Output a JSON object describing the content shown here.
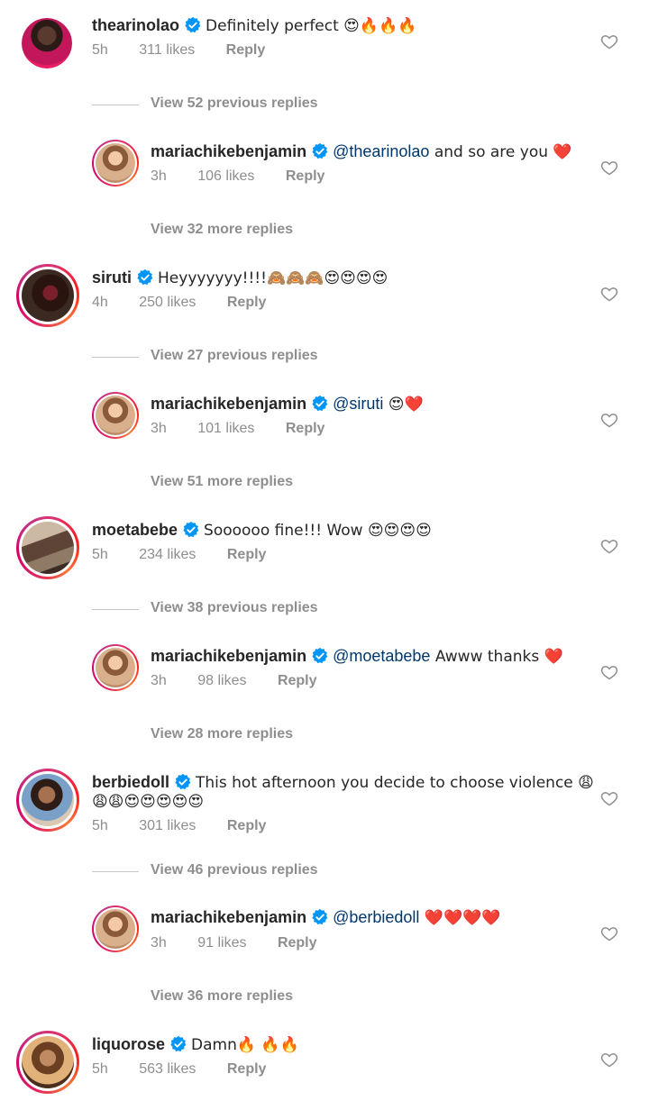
{
  "comments": [
    {
      "username": "thearinolao",
      "text": "Definitely perfect 😍🔥🔥🔥",
      "time": "5h",
      "likes": "311 likes",
      "reply": "Reply",
      "view_label": "View 52 previous replies",
      "reply_item": {
        "username": "mariachikebenjamin",
        "mention": "@thearinolao",
        "text": " and so are you ❤️",
        "time": "3h",
        "likes": "106 likes",
        "reply": "Reply"
      },
      "more_label": "View 32 more replies"
    },
    {
      "username": "siruti",
      "text": "Heyyyyyyy!!!!🙈🙈🙈😍😍😍😍",
      "time": "4h",
      "likes": "250 likes",
      "reply": "Reply",
      "view_label": "View 27 previous replies",
      "reply_item": {
        "username": "mariachikebenjamin",
        "mention": "@siruti",
        "text": " 😍❤️",
        "time": "3h",
        "likes": "101 likes",
        "reply": "Reply"
      },
      "more_label": "View 51 more replies"
    },
    {
      "username": "moetabebe",
      "text": "Soooooo fine!!! Wow 😍😍😍😍",
      "time": "5h",
      "likes": "234 likes",
      "reply": "Reply",
      "view_label": "View 38 previous replies",
      "reply_item": {
        "username": "mariachikebenjamin",
        "mention": "@moetabebe",
        "text": " Awww thanks ❤️",
        "time": "3h",
        "likes": "98 likes",
        "reply": "Reply"
      },
      "more_label": "View 28 more replies"
    },
    {
      "username": "berbiedoll",
      "text": "This hot afternoon you decide to choose violence 😩",
      "text2": "😩😩😍😍😍😍😍",
      "time": "5h",
      "likes": "301 likes",
      "reply": "Reply",
      "view_label": "View 46 previous replies",
      "reply_item": {
        "username": "mariachikebenjamin",
        "mention": "@berbiedoll",
        "text": " ❤️❤️❤️❤️",
        "time": "3h",
        "likes": "91 likes",
        "reply": "Reply"
      },
      "more_label": "View 36 more replies"
    },
    {
      "username": "liquorose",
      "text": "Damn🔥 🔥🔥",
      "time": "5h",
      "likes": "563 likes",
      "reply": "Reply"
    }
  ],
  "icons": {
    "verified": "verified-badge-icon",
    "like": "heart-outline-icon"
  },
  "colors": {
    "verified_blue": "#0095f6",
    "mention_blue": "#00376b",
    "meta_gray": "#8e8e8e",
    "story_ring": "#d6006b"
  }
}
